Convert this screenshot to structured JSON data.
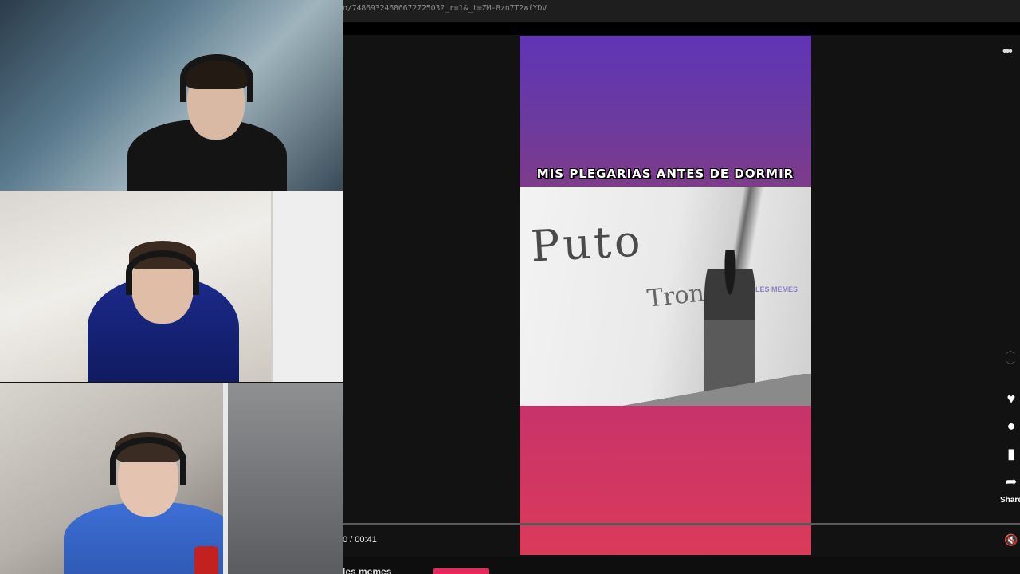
{
  "browser": {
    "url": "o/7486932468667272503?_r=1&_t=ZM-8zn7T2WfYDV"
  },
  "video": {
    "caption": "MIS PLEGARIAS ANTES DE DORMIR",
    "graffiti_line1": "Puto",
    "graffiti_line2": "Tron",
    "watermark": "LES MEMES",
    "colors": {
      "top": "#6034b6",
      "bottom": "#db3a5a"
    }
  },
  "player": {
    "more_icon": "more-horizontal-icon",
    "time": "0 / 00:41",
    "actions": [
      {
        "icon": "heart-icon",
        "glyph": "♥"
      },
      {
        "icon": "comment-icon",
        "glyph": "●"
      },
      {
        "icon": "bookmark-icon",
        "glyph": "▮"
      },
      {
        "icon": "share-icon",
        "glyph": "➦"
      }
    ],
    "share_label": "Share",
    "mute_icon": "speaker-muted-icon"
  },
  "footer": {
    "account_label": "les memes"
  }
}
